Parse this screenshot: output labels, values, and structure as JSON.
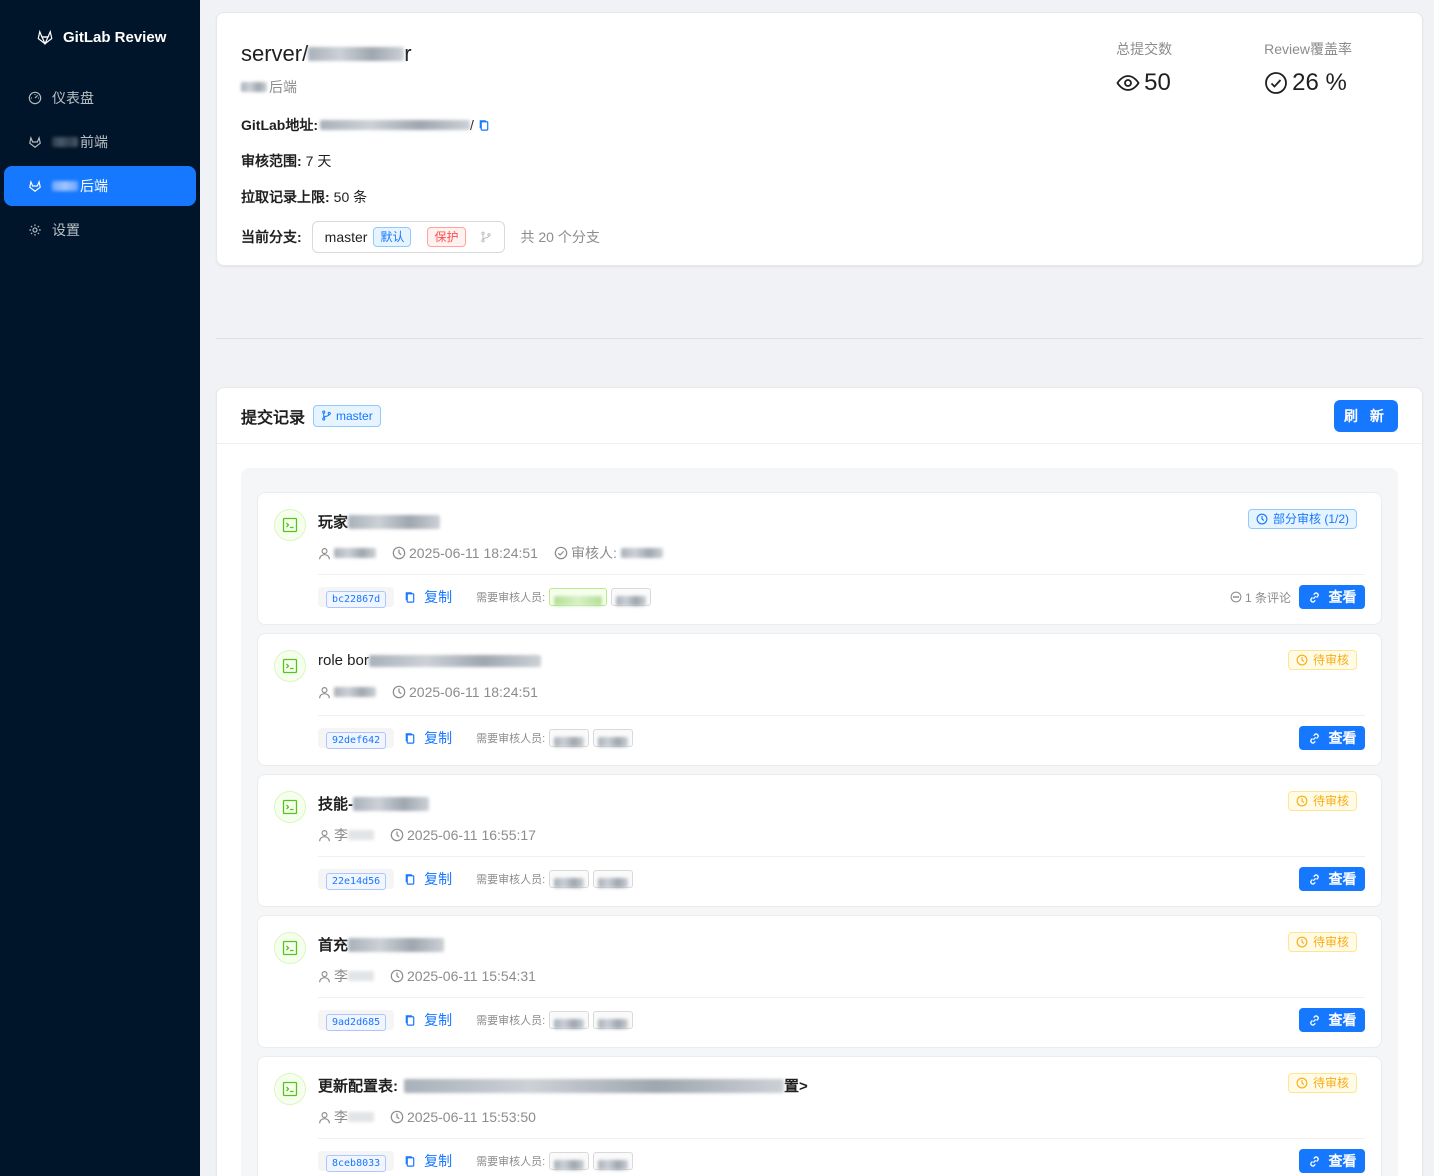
{
  "app": {
    "title": "GitLab Review"
  },
  "sidebar": {
    "items": [
      {
        "label": "仪表盘"
      },
      {
        "label": "前端"
      },
      {
        "label": "后端"
      },
      {
        "label": "设置"
      }
    ]
  },
  "project": {
    "title_prefix": "server/",
    "title_suffix": "r",
    "subtitle": "后端",
    "gitlab_label": "GitLab地址:",
    "gitlab_url_tail": "/",
    "range_label": "审核范围:",
    "range_value": "7 天",
    "limit_label": "拉取记录上限:",
    "limit_value": "50 条",
    "branch_label": "当前分支:",
    "branch_value": "master",
    "tag_default": "默认",
    "tag_protect": "保护",
    "branch_count": "共 20 个分支"
  },
  "stats": {
    "total_label": "总提交数",
    "total_value": "50",
    "coverage_label": "Review覆盖率",
    "coverage_value": "26 %"
  },
  "commits_section": {
    "title": "提交记录",
    "branch": "master",
    "refresh_label": "刷 新"
  },
  "commits": [
    {
      "title": "玩家",
      "author": "",
      "time": "2025-06-11 18:24:51",
      "reviewer_label": "审核人:",
      "hash": "bc22867d",
      "status": "部分审核 (1/2)",
      "comments": "1 条评论"
    },
    {
      "title": "role bor",
      "author": "",
      "time": "2025-06-11 18:24:51",
      "hash": "92def642",
      "status": "待审核"
    },
    {
      "title": "技能-",
      "author": "李",
      "time": "2025-06-11 16:55:17",
      "hash": "22e14d56",
      "status": "待审核"
    },
    {
      "title": "首充",
      "author": "李",
      "time": "2025-06-11 15:54:31",
      "hash": "9ad2d685",
      "status": "待审核"
    },
    {
      "title": "更新配置表:",
      "title_tail": "置>",
      "author": "李",
      "time": "2025-06-11 15:53:50",
      "hash": "8ceb8033",
      "status": "待审核"
    }
  ],
  "commit_common": {
    "copy_label": "复制",
    "reviewers_needed": "需要审核人员:",
    "view_label": "查看"
  },
  "colors": {
    "primary": "#1677ff",
    "sidebar": "#001529",
    "warning": "#faad14",
    "danger": "#ff4d4f"
  }
}
